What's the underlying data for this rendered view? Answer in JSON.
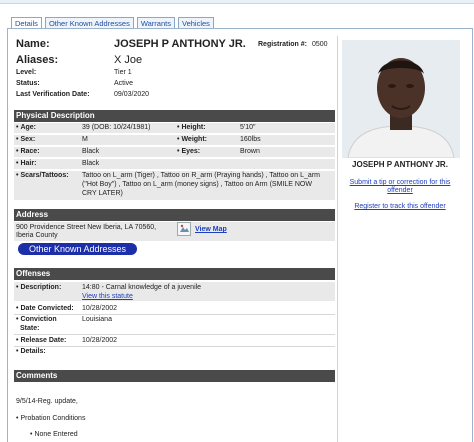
{
  "tabs": [
    "Details",
    "Other Known Addresses",
    "Warrants",
    "Vehicles"
  ],
  "identity": {
    "name_label": "Name:",
    "name": "JOSEPH P ANTHONY JR.",
    "reg_label": "Registration #:",
    "reg_value": "0500",
    "aliases_label": "Aliases:",
    "aliases": "X Joe",
    "level_label": "Level:",
    "level": "Tier 1",
    "status_label": "Status:",
    "status": "Active",
    "verif_label": "Last Verification Date:",
    "verif": "09/03/2020"
  },
  "physical": {
    "header": "Physical Description",
    "age_label": "Age:",
    "age": "39  (DOB: 10/24/1981)",
    "height_label": "Height:",
    "height": "5'10\"",
    "sex_label": "Sex:",
    "sex": "M",
    "weight_label": "Weight:",
    "weight": "160lbs",
    "race_label": "Race:",
    "race": "Black",
    "eyes_label": "Eyes:",
    "eyes": "Brown",
    "hair_label": "Hair:",
    "hair": "Black",
    "scars_label": "Scars/Tattoos:",
    "scars_1": "Tattoo on L_arm (Tiger) , Tattoo on R_arm (Praying hands) , Tattoo on L_arm",
    "scars_2": "(\"Hot Boy\") , Tattoo on L_arm (money signs) , Tattoo on Arm (SMILE NOW",
    "scars_3": "CRY LATER)"
  },
  "address": {
    "header": "Address",
    "line1": "900 Providence Street New Iberia, LA 70560,",
    "line2": "Iberia County",
    "map_link": "View Map",
    "other_button": "Other Known Addresses"
  },
  "offenses": {
    "header": "Offenses",
    "desc_label": "Description:",
    "desc": "14:80 - Carnal knowledge of a juvenile",
    "statute_link": "View this statute",
    "convicted_label": "Date Convicted:",
    "convicted": "10/28/2002",
    "state_label_1": "Conviction",
    "state_label_2": "State:",
    "state": "Louisiana",
    "release_label": "Release Date:",
    "release": "10/28/2002",
    "details_label": "Details:"
  },
  "comments": {
    "header": "Comments",
    "text": "9/5/14-Reg. update,",
    "probation_label": "Probation Conditions",
    "none": "None Entered"
  },
  "sidebar": {
    "name": "JOSEPH P ANTHONY JR.",
    "tip_link_1": "Submit a tip or correction for this",
    "tip_link_2": "offender",
    "track_link": "Register to track this offender"
  }
}
